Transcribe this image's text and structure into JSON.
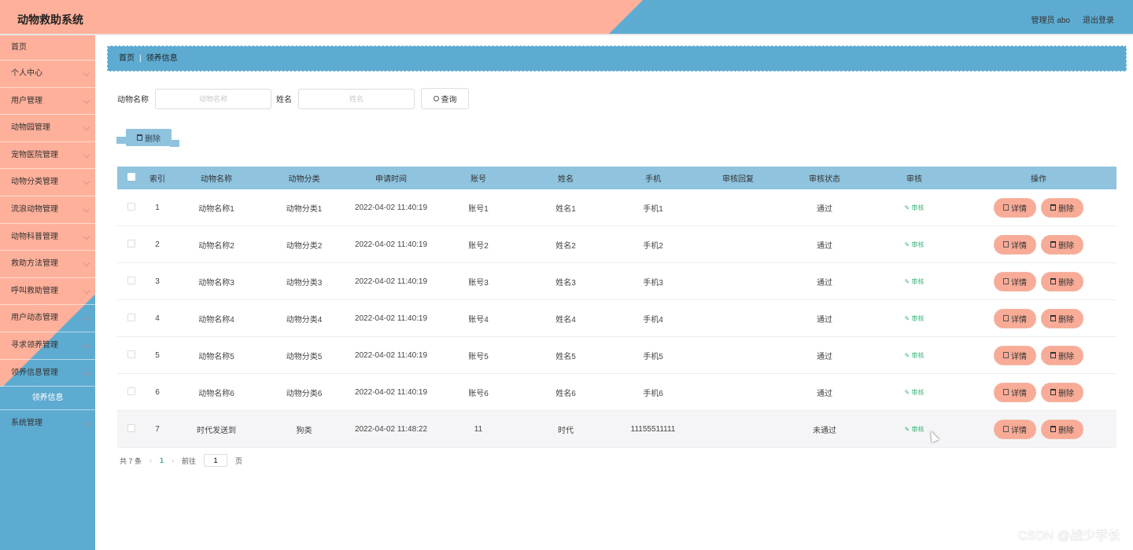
{
  "header": {
    "title": "动物救助系统",
    "user": "管理员 abo",
    "logout": "退出登录"
  },
  "sidebar": {
    "items": [
      {
        "label": "首页"
      },
      {
        "label": "个人中心"
      },
      {
        "label": "用户管理"
      },
      {
        "label": "动物园管理"
      },
      {
        "label": "宠物医院管理"
      },
      {
        "label": "动物分类管理"
      },
      {
        "label": "流浪动物管理"
      },
      {
        "label": "动物科普管理"
      },
      {
        "label": "救助方法管理"
      },
      {
        "label": "呼叫救助管理"
      },
      {
        "label": "用户动态管理"
      },
      {
        "label": "寻求领养管理"
      },
      {
        "label": "领养信息管理"
      }
    ],
    "sub_active": "领养信息",
    "last": "系统管理"
  },
  "breadcrumb": {
    "home": "首页",
    "sep": "|",
    "current": "领养信息"
  },
  "search": {
    "animal_label": "动物名称",
    "animal_placeholder": "动物名称",
    "name_label": "姓名",
    "name_placeholder": "姓名",
    "query_label": "查询"
  },
  "toolbar": {
    "delete_label": "删除"
  },
  "table": {
    "headers": [
      "索引",
      "动物名称",
      "动物分类",
      "申请时间",
      "账号",
      "姓名",
      "手机",
      "审核回复",
      "审核状态",
      "审核",
      "操作"
    ],
    "rows": [
      {
        "idx": "1",
        "name": "动物名称1",
        "cat": "动物分类1",
        "time": "2022-04-02 11:40:19",
        "acc": "账号1",
        "uname": "姓名1",
        "phone": "手机1",
        "reply": "",
        "status": "通过"
      },
      {
        "idx": "2",
        "name": "动物名称2",
        "cat": "动物分类2",
        "time": "2022-04-02 11:40:19",
        "acc": "账号2",
        "uname": "姓名2",
        "phone": "手机2",
        "reply": "",
        "status": "通过"
      },
      {
        "idx": "3",
        "name": "动物名称3",
        "cat": "动物分类3",
        "time": "2022-04-02 11:40:19",
        "acc": "账号3",
        "uname": "姓名3",
        "phone": "手机3",
        "reply": "",
        "status": "通过"
      },
      {
        "idx": "4",
        "name": "动物名称4",
        "cat": "动物分类4",
        "time": "2022-04-02 11:40:19",
        "acc": "账号4",
        "uname": "姓名4",
        "phone": "手机4",
        "reply": "",
        "status": "通过"
      },
      {
        "idx": "5",
        "name": "动物名称5",
        "cat": "动物分类5",
        "time": "2022-04-02 11:40:19",
        "acc": "账号5",
        "uname": "姓名5",
        "phone": "手机5",
        "reply": "",
        "status": "通过"
      },
      {
        "idx": "6",
        "name": "动物名称6",
        "cat": "动物分类6",
        "time": "2022-04-02 11:40:19",
        "acc": "账号6",
        "uname": "姓名6",
        "phone": "手机6",
        "reply": "",
        "status": "通过"
      },
      {
        "idx": "7",
        "name": "时代发送到",
        "cat": "狗类",
        "time": "2022-04-02 11:48:22",
        "acc": "11",
        "uname": "时代",
        "phone": "11155511111",
        "reply": "",
        "status": "未通过"
      }
    ],
    "audit_label": "审核",
    "detail_label": "详情",
    "delete_label": "删除"
  },
  "pager": {
    "total": "共 7 条",
    "prev": "‹",
    "current": "1",
    "next": "›",
    "goto": "前往",
    "page_value": "1",
    "page_unit": "页"
  },
  "watermark": "CSDN @战少学长",
  "colors": {
    "peach": "#ffb09a",
    "blue": "#5eabd1",
    "table_header": "#8fc3de",
    "button": "#f8ab96",
    "audit": "#3bb47a"
  }
}
